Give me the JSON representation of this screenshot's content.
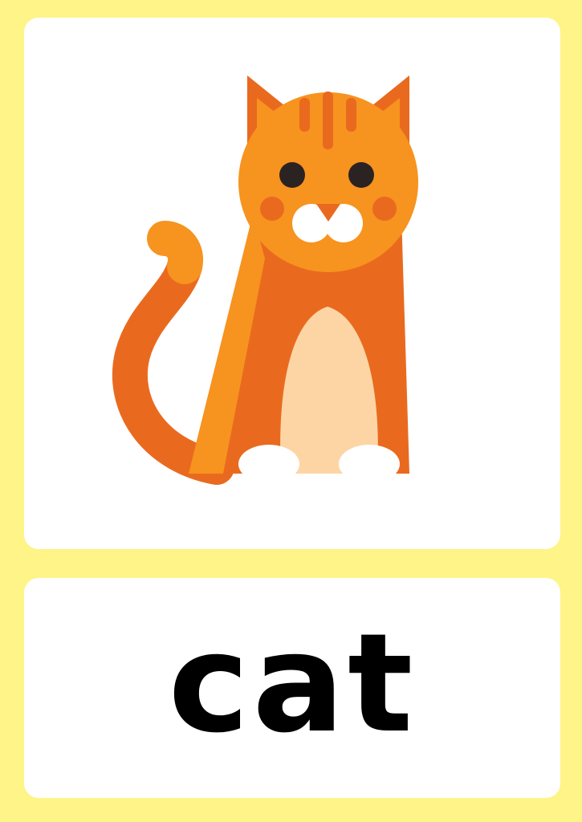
{
  "flashcard": {
    "word": "cat",
    "illustration_icon": "cat-icon"
  },
  "colors": {
    "background": "#fef488",
    "card": "#ffffff",
    "text": "#000000",
    "fur_dark": "#e96a1f",
    "fur_light": "#f7931f",
    "belly": "#fdd5a4",
    "paws": "#ffffff"
  }
}
